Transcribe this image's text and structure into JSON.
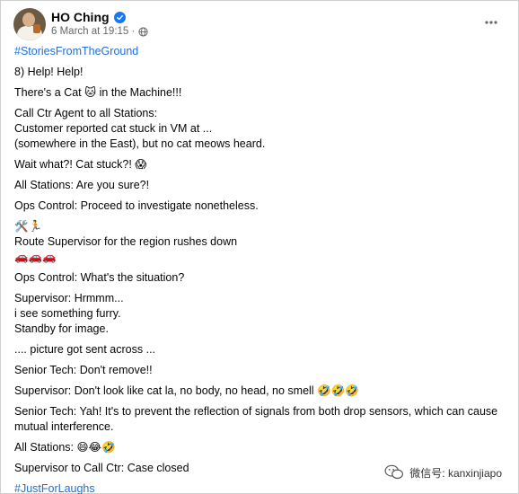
{
  "post": {
    "author": "HO Ching",
    "timestamp": "6 March at 19:15 ·",
    "visibility_icon": "globe-icon",
    "verified_icon": "verified-badge-icon",
    "more_icon": "more-options-icon"
  },
  "lines": {
    "hashtag_top": "#StoriesFromTheGround",
    "l1": "8) Help! Help!",
    "l2": "There's a Cat 🐱 in the Machine!!!",
    "l3": "Call Ctr Agent to all Stations:\nCustomer reported cat stuck in VM at  ...\n(somewhere in the East), but no cat meows heard.",
    "l4": "Wait what?! Cat stuck?! 😱",
    "l5": "All Stations: Are you sure?!",
    "l6": "Ops Control: Proceed to investigate nonetheless.",
    "l7a": "🛠️🏃",
    "l7b": "Route Supervisor for the region rushes down",
    "l7c": "🚗🚗🚗",
    "l8": "Ops Control: What's the situation?",
    "l9": "Supervisor: Hrmmm...\ni see something furry.\nStandby for image.",
    "l10": ".... picture got sent across ...",
    "l11": "Senior Tech: Don't remove!!",
    "l12": "Supervisor: Don't look like cat la, no body, no head, no smell 🤣🤣🤣",
    "l13": "Senior Tech: Yah! It's to prevent the reflection of signals from both drop sensors, which can cause\nmutual interference.",
    "l14": "All Stations: 😄😂🤣",
    "l15": "Supervisor to Call Ctr: Case closed",
    "hashtag_bottom": "#JustForLaughs"
  },
  "watermark": {
    "text": "微信号: kanxinjiapo",
    "icon": "wechat-icon"
  },
  "colors": {
    "hashtag": "#216fdb",
    "meta": "#65676b",
    "verified": "#1877f2"
  }
}
